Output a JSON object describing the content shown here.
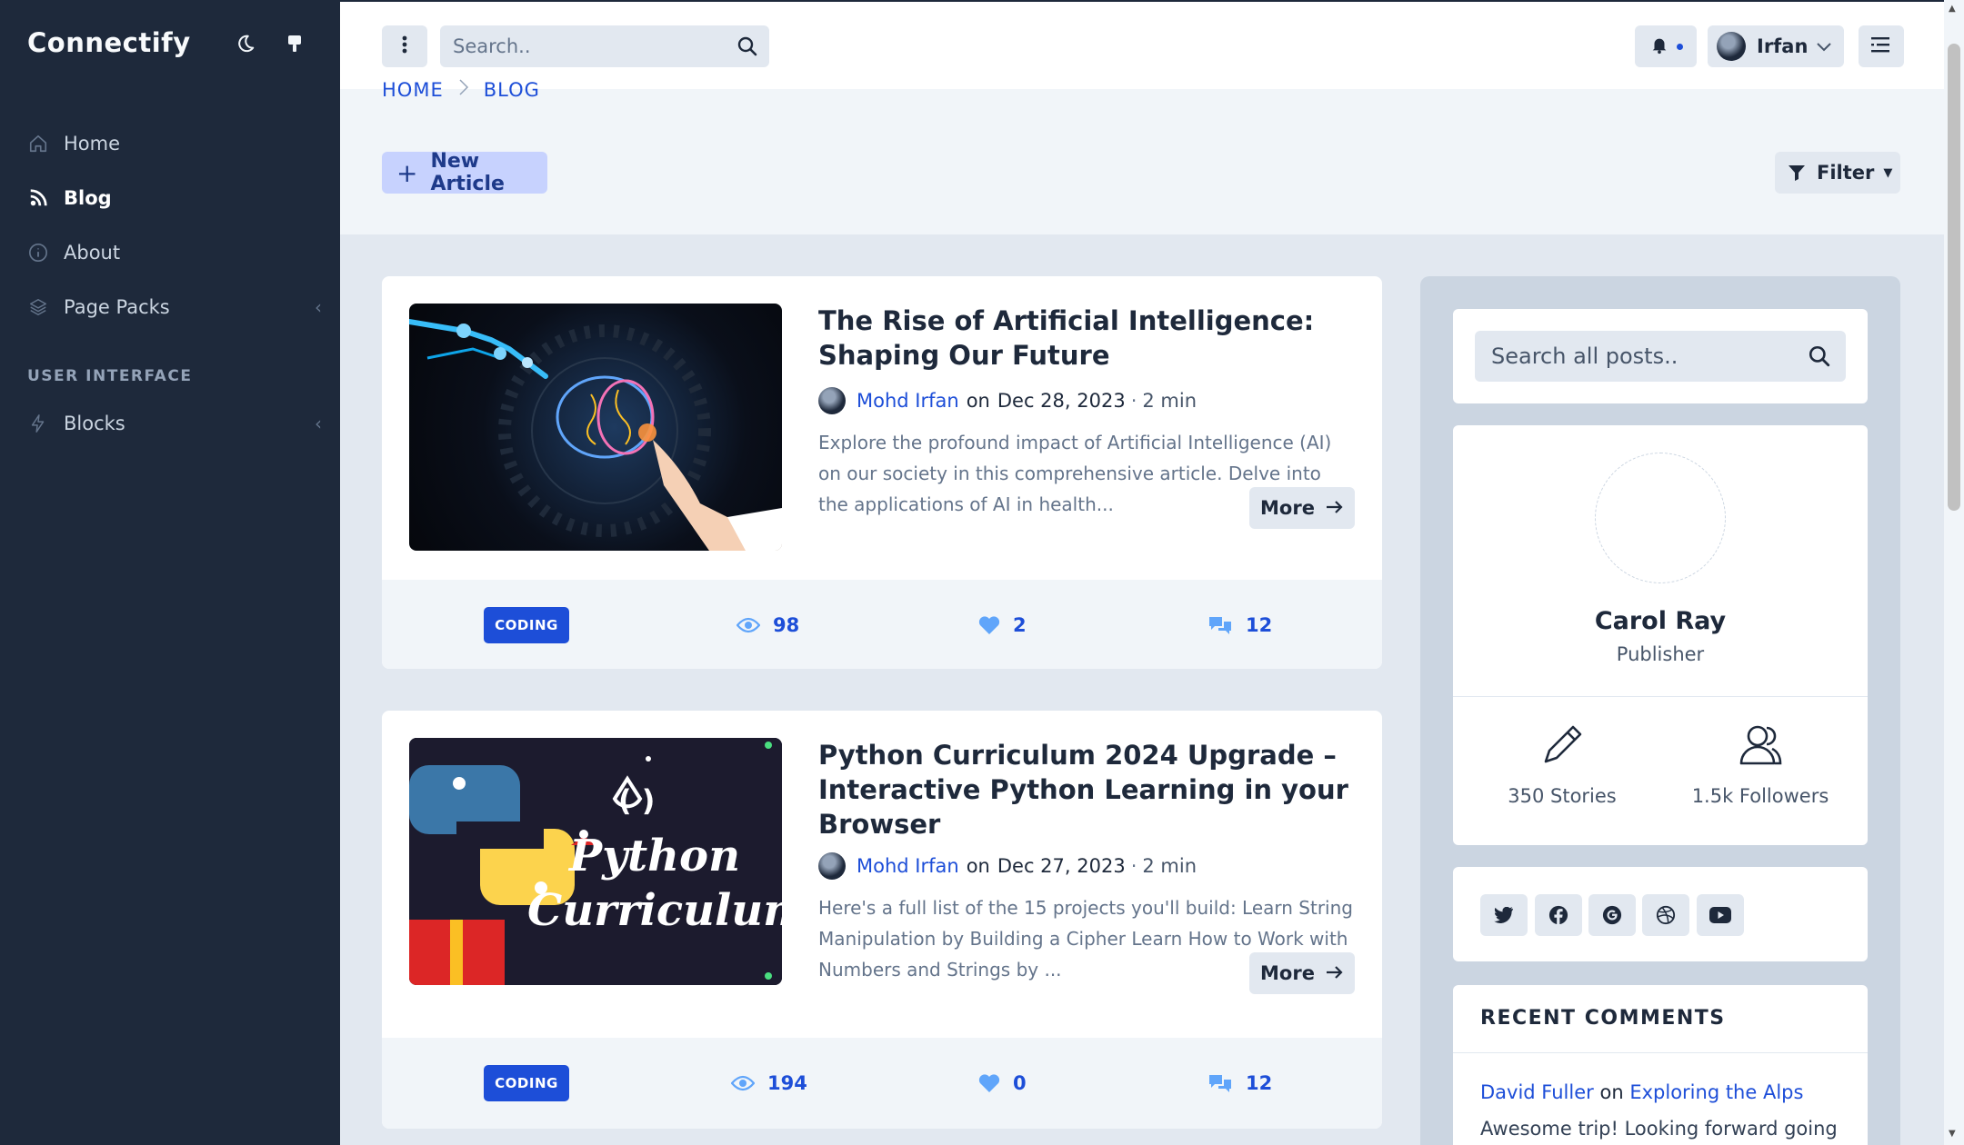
{
  "app": {
    "brand": "Connectify"
  },
  "sidebar": {
    "items": [
      {
        "label": "Home"
      },
      {
        "label": "Blog"
      },
      {
        "label": "About"
      },
      {
        "label": "Page Packs"
      }
    ],
    "section_title": "USER INTERFACE",
    "section_items": [
      {
        "label": "Blocks"
      }
    ]
  },
  "topbar": {
    "search_placeholder": "Search..",
    "user_name": "Irfan"
  },
  "breadcrumb": {
    "home": "HOME",
    "current": "BLOG"
  },
  "toolbar": {
    "new_article_label": "New Article",
    "filter_label": "Filter"
  },
  "articles": [
    {
      "title": "The Rise of Artificial Intelligence: Shaping Our Future",
      "author": "Mohd Irfan",
      "on": "on",
      "date": "Dec 28, 2023",
      "read_time": "2 min",
      "excerpt": "Explore the profound impact of Artificial Intelligence (AI) on our society in this comprehensive article. Delve into the applications of AI in health...",
      "more_label": "More",
      "category": "CODING",
      "views": "98",
      "likes": "2",
      "comments": "12"
    },
    {
      "title": "Python Curriculum 2024 Upgrade – Interactive Python Learning in your Browser",
      "author": "Mohd Irfan",
      "on": "on",
      "date": "Dec 27, 2023",
      "read_time": "2 min",
      "excerpt": "Here's a full list of the 15 projects you'll build: Learn String Manipulation by Building a Cipher Learn How to Work with Numbers and Strings by ...",
      "more_label": "More",
      "category": "CODING",
      "views": "194",
      "likes": "0",
      "comments": "12",
      "image_text": [
        "Python",
        "Curriculum"
      ]
    }
  ],
  "right_sidebar": {
    "search_placeholder": "Search all posts..",
    "profile": {
      "name": "Carol Ray",
      "role": "Publisher",
      "stories": "350 Stories",
      "followers": "1.5k Followers"
    },
    "socials": [
      "twitter-icon",
      "facebook-icon",
      "google-icon",
      "dribbble-icon",
      "youtube-icon"
    ],
    "recent_comments": {
      "title": "RECENT COMMENTS",
      "items": [
        {
          "author": "David Fuller",
          "on": "on",
          "post": "Exploring the Alps",
          "text": "Awesome trip! Looking forward going"
        }
      ]
    }
  },
  "colors": {
    "accent": "#1d4ed8",
    "sidebar_bg": "#1e293b",
    "badge": "#1d4ed8"
  }
}
